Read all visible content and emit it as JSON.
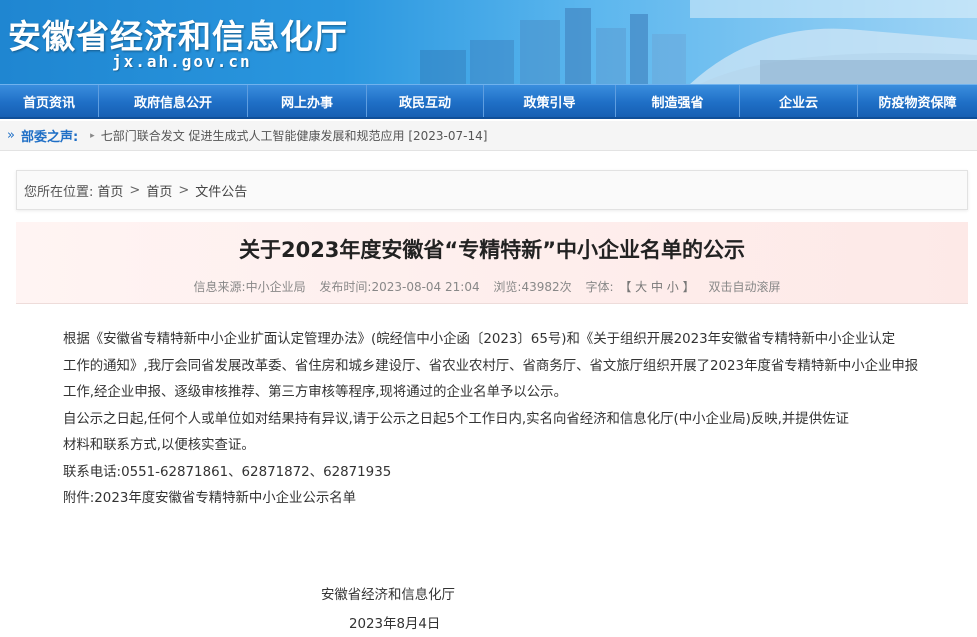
{
  "header": {
    "site_title": "安徽省经济和信息化厅",
    "site_domain": "jx.ah.gov.cn"
  },
  "nav": {
    "items": [
      {
        "label": "首页资讯"
      },
      {
        "label": "政府信息公开"
      },
      {
        "label": "网上办事"
      },
      {
        "label": "政民互动"
      },
      {
        "label": "政策引导"
      },
      {
        "label": "制造强省"
      },
      {
        "label": "企业云"
      },
      {
        "label": "防疫物资保障"
      }
    ]
  },
  "ticker": {
    "label": "部委之声:",
    "news": "七部门联合发文 促进生成式人工智能健康发展和规范应用 [2023-07-14]"
  },
  "breadcrumb": {
    "prefix": "您所在位置:",
    "items": [
      "首页",
      "首页",
      "文件公告"
    ],
    "separator": ">"
  },
  "article": {
    "title": "关于2023年度安徽省“专精特新”中小企业名单的公示",
    "meta": {
      "source": "信息来源:中小企业局",
      "publish_time": "发布时间:2023-08-04 21:04",
      "views": "浏览:43982次",
      "font_label": "字体:",
      "font_size_control": "【 大 中 小 】",
      "auto_scroll": "双击自动滚屏"
    },
    "paragraphs": [
      "根据《安徽省专精特新中小企业扩面认定管理办法》(皖经信中小企函〔2023〕65号)和《关于组织开展2023年安徽省专精特新中小企业认定",
      "工作的通知》,我厅会同省发展改革委、省住房和城乡建设厅、省农业农村厅、省商务厅、省文旅厅组织开展了2023年度省专精特新中小企业申报",
      "工作,经企业申报、逐级审核推荐、第三方审核等程序,现将通过的企业名单予以公示。",
      "自公示之日起,任何个人或单位如对结果持有异议,请于公示之日起5个工作日内,实名向省经济和信息化厅(中小企业局)反映,并提供佐证",
      "材料和联系方式,以便核实查证。",
      "联系电话:0551-62871861、62871872、62871935"
    ],
    "attachment": "附件:2023年度安徽省专精特新中小企业公示名单",
    "signature": "安徽省经济和信息化厅",
    "date": "2023年8月4日"
  },
  "colors": {
    "nav_blue": "#1f6fc6",
    "title_bg": "#fdeeec"
  }
}
